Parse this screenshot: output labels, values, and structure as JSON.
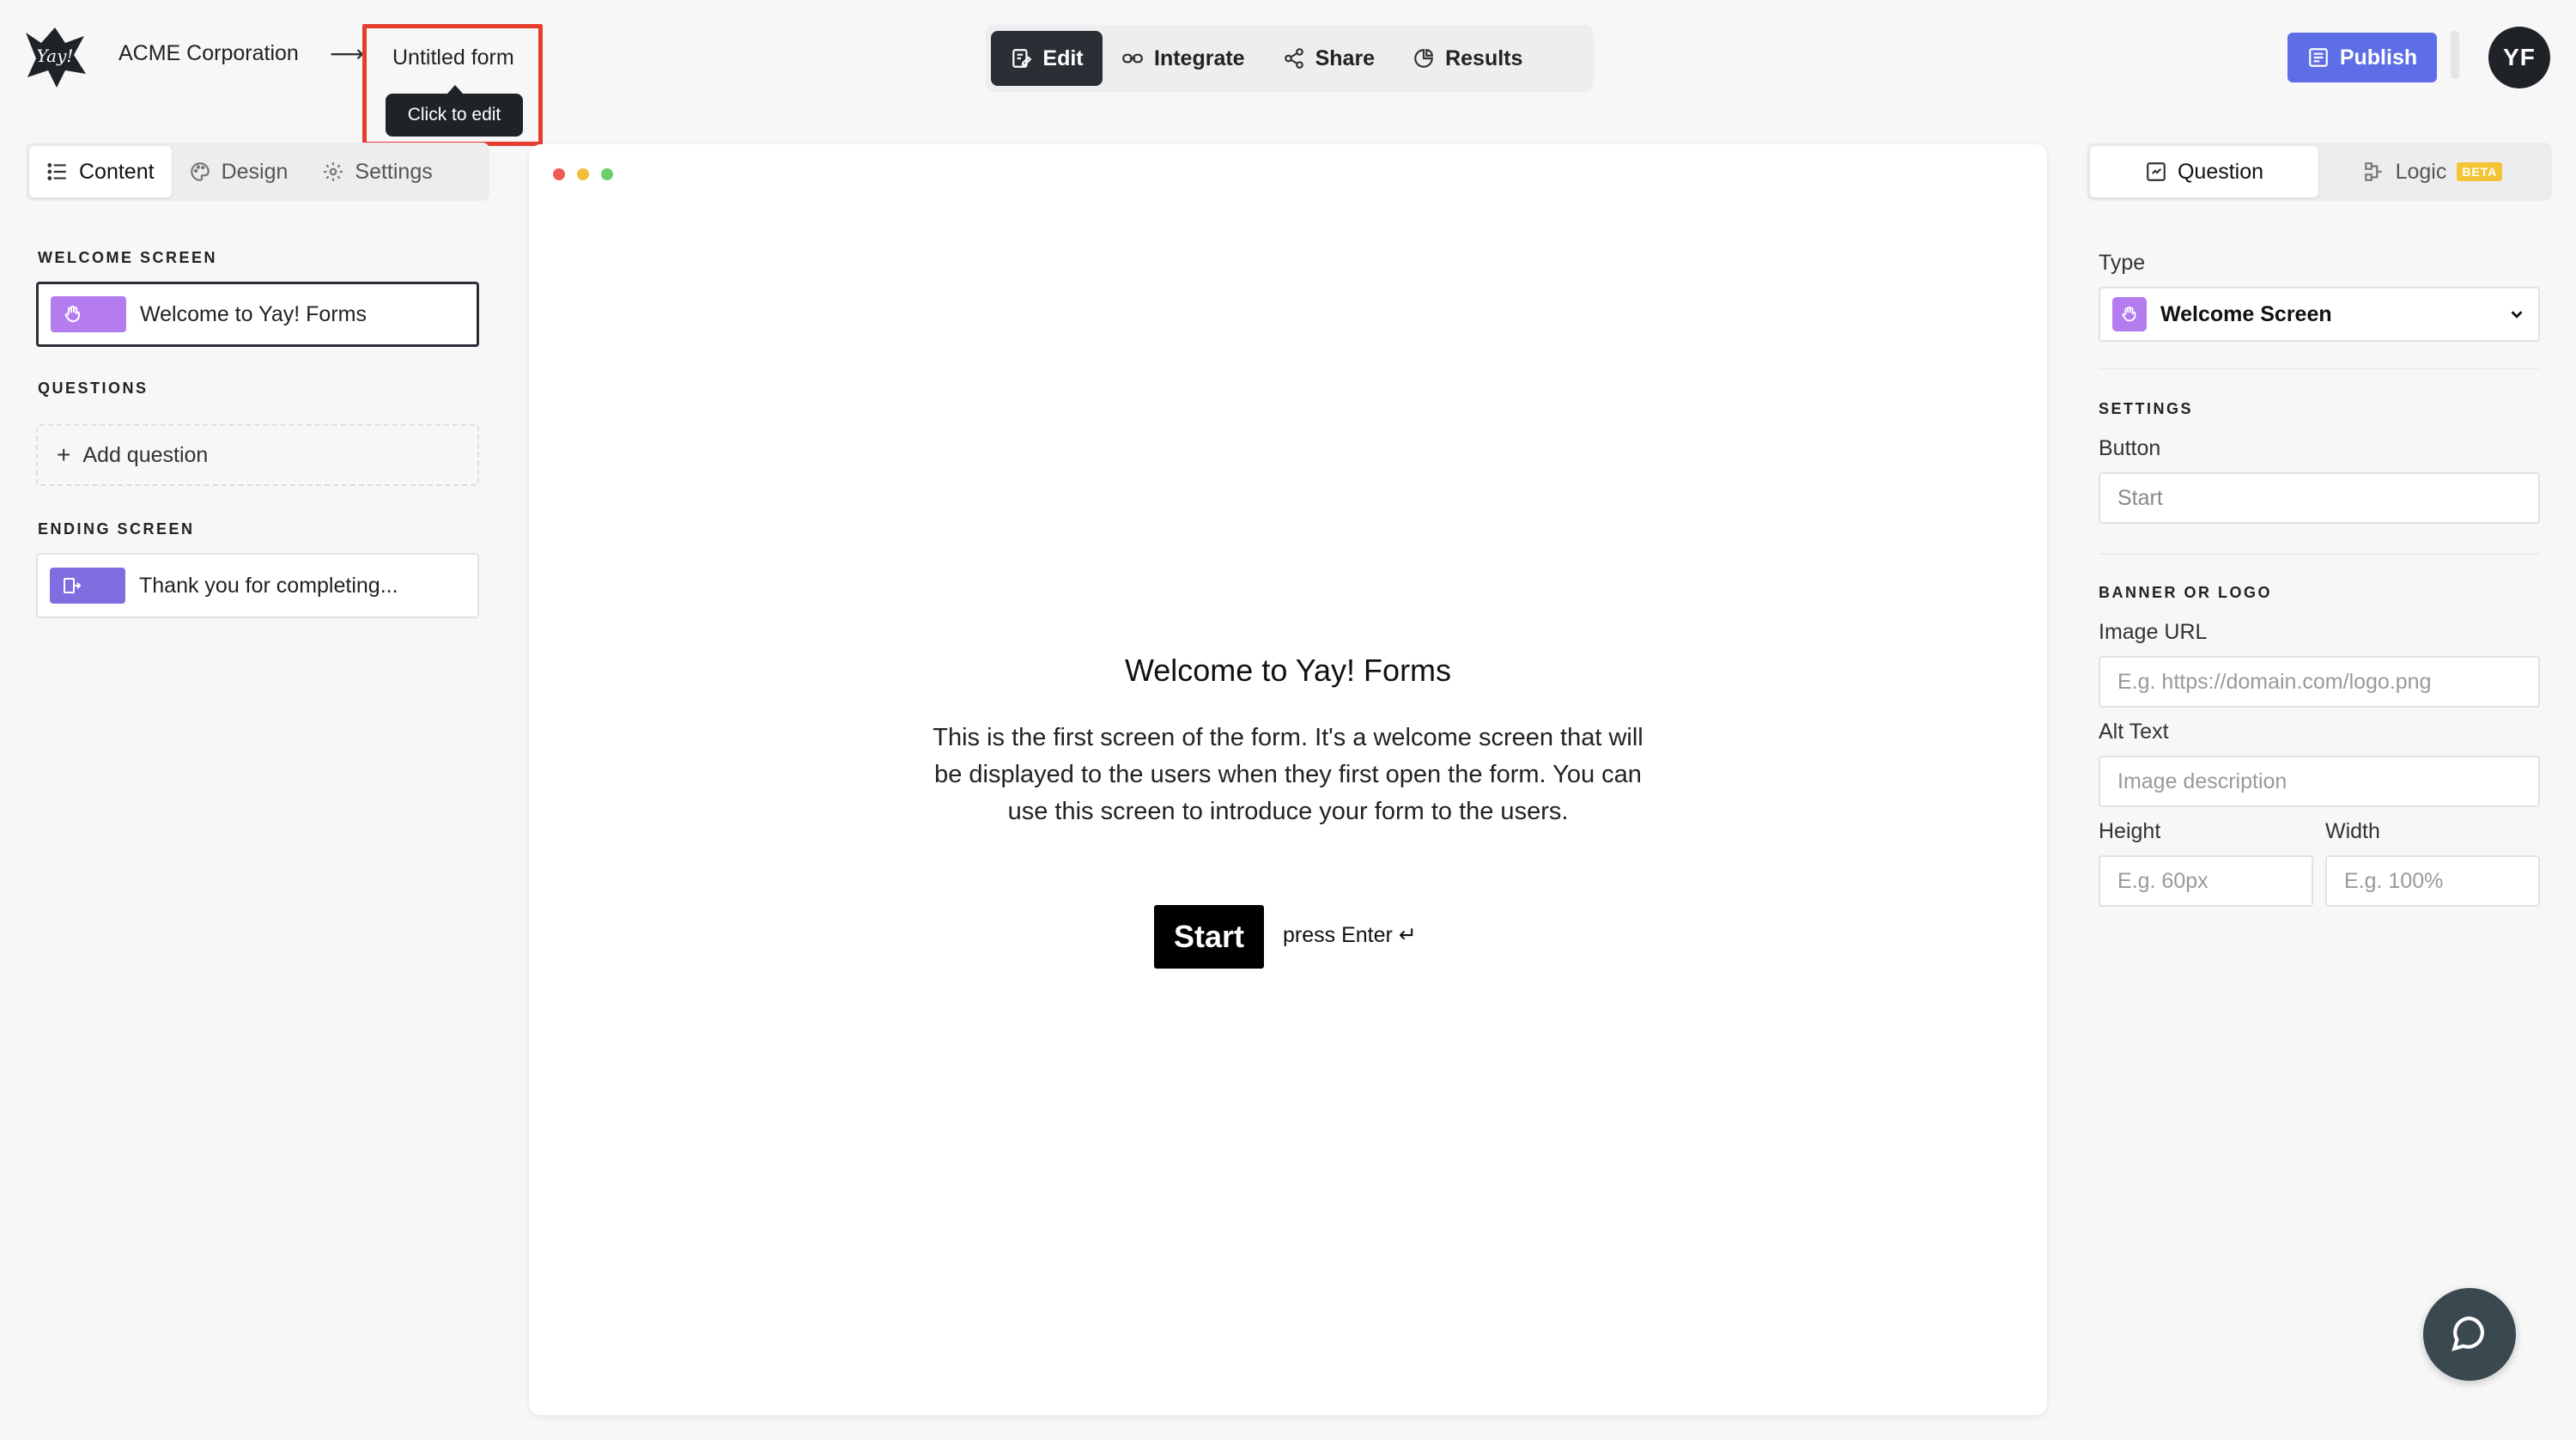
{
  "header": {
    "org_name": "ACME Corporation",
    "arrow": "⟶",
    "form_title": "Untitled form",
    "tooltip": "Click to edit",
    "tabs": [
      {
        "label": "Edit",
        "icon": "edit-icon",
        "active": true
      },
      {
        "label": "Integrate",
        "icon": "link-icon",
        "active": false
      },
      {
        "label": "Share",
        "icon": "share-icon",
        "active": false
      },
      {
        "label": "Results",
        "icon": "results-icon",
        "active": false
      }
    ],
    "publish_label": "Publish",
    "avatar_initials": "YF"
  },
  "left_panel": {
    "tabs": [
      {
        "label": "Content",
        "icon": "list-icon",
        "active": true
      },
      {
        "label": "Design",
        "icon": "palette-icon",
        "active": false
      },
      {
        "label": "Settings",
        "icon": "gear-icon",
        "active": false
      }
    ],
    "welcome_section": "WELCOME SCREEN",
    "welcome_item": "Welcome to Yay! Forms",
    "questions_section": "QUESTIONS",
    "add_question": "Add question",
    "ending_section": "ENDING SCREEN",
    "ending_item": "Thank you for completing..."
  },
  "canvas": {
    "title": "Welcome to Yay! Forms",
    "description": "This is the first screen of the form. It's a welcome screen that will be displayed to the users when they first open the form. You can use this screen to introduce your form to the users.",
    "start_label": "Start",
    "press_enter": "press Enter ↵"
  },
  "right_panel": {
    "tabs": [
      {
        "label": "Question",
        "icon": "question-icon",
        "active": true
      },
      {
        "label": "Logic",
        "icon": "logic-icon",
        "active": false,
        "badge": "BETA"
      }
    ],
    "type_label": "Type",
    "type_value": "Welcome Screen",
    "settings_section": "SETTINGS",
    "button_label": "Button",
    "button_value": "Start",
    "banner_section": "BANNER OR LOGO",
    "image_url_label": "Image URL",
    "image_url_placeholder": "E.g. https://domain.com/logo.png",
    "alt_text_label": "Alt Text",
    "alt_text_placeholder": "Image description",
    "height_label": "Height",
    "height_placeholder": "E.g. 60px",
    "width_label": "Width",
    "width_placeholder": "E.g. 100%"
  },
  "colors": {
    "accent": "#5e6ee6",
    "highlight_border": "#e53d2f",
    "welcome_icon": "#b57cf0",
    "ending_icon": "#7f6ee0",
    "dot_red": "#ee5d53",
    "dot_yellow": "#f4be3a",
    "dot_green": "#6ccf6e"
  }
}
